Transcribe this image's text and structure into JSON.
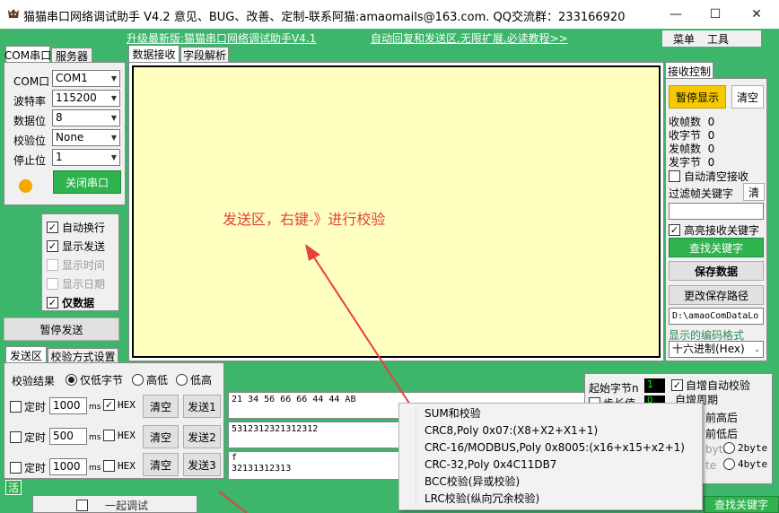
{
  "window": {
    "title": "猫猫串口网络调试助手 V4.2 意见、BUG、改善、定制-联系阿猫:amaomails@163.com. QQ交流群：233166920",
    "controls": [
      "—",
      "☐",
      "✕"
    ]
  },
  "topbar": {
    "upgrade_link": "升级最新版:猫猫串口网络调试助手V4.1",
    "auto_link": "自动回复和发送区,无限扩展,必读教程>>",
    "menu": "菜单",
    "tools": "工具"
  },
  "left_tabs": [
    "COM串口",
    "服务器"
  ],
  "serial": {
    "fields": [
      {
        "label": "COM口",
        "value": "COM1"
      },
      {
        "label": "波特率",
        "value": "115200"
      },
      {
        "label": "数据位",
        "value": "8"
      },
      {
        "label": "校验位",
        "value": "None"
      },
      {
        "label": "停止位",
        "value": "1"
      }
    ],
    "close_button": "关闭串口",
    "status_color": "#f5a700"
  },
  "options": [
    {
      "label": "自动换行",
      "checked": true,
      "enabled": true
    },
    {
      "label": "显示发送",
      "checked": true,
      "enabled": true
    },
    {
      "label": "显示时间",
      "checked": false,
      "enabled": false
    },
    {
      "label": "显示日期",
      "checked": false,
      "enabled": false
    },
    {
      "label": "仅数据",
      "checked": true,
      "enabled": true
    }
  ],
  "pause_send": "暂停发送",
  "center_tabs": [
    "数据接收",
    "字段解析"
  ],
  "annotation": "发送区，右键-》进行校验",
  "receive_control": {
    "tab": "接收控制",
    "pause_display": "暂停显示",
    "clear": "清空",
    "stats": [
      {
        "label": "收帧数",
        "value": "0"
      },
      {
        "label": "收字节",
        "value": "0"
      },
      {
        "label": "发帧数",
        "value": "0"
      },
      {
        "label": "发字节",
        "value": "0"
      }
    ],
    "auto_clear": "自动清空接收",
    "filter_label": "过滤帧关键字",
    "filter_clear": "清",
    "highlight": "高亮接收关键字",
    "find_keyword": "查找关键字",
    "save_data": "保存数据",
    "change_path": "更改保存路径",
    "path": "D:\\amaoComDataLo",
    "encoding_label": "显示的编码格式",
    "encoding": "十六进制(Hex)"
  },
  "send_tabs": [
    "发送区",
    "校验方式设置"
  ],
  "checksum": {
    "label": "校验结果",
    "options": [
      {
        "label": "仅低字节",
        "selected": true
      },
      {
        "label": "高低",
        "selected": false
      },
      {
        "label": "低高",
        "selected": false
      }
    ]
  },
  "send_rows": [
    {
      "timer": "定时",
      "interval": "1000",
      "unit": "ms",
      "hex": "HEX",
      "hex_checked": true,
      "clear": "清空",
      "send": "发送1",
      "data": "21 34 56 66 66 44 44 AB"
    },
    {
      "timer": "定时",
      "interval": "500",
      "unit": "ms",
      "hex": "HEX",
      "hex_checked": false,
      "clear": "清空",
      "send": "发送2",
      "data": "5312312321312312"
    },
    {
      "timer": "定时",
      "interval": "1000",
      "unit": "ms",
      "hex": "HEX",
      "hex_checked": false,
      "clear": "清空",
      "send": "发送3",
      "data_line1": "f",
      "data_line2": "32131312313"
    }
  ],
  "right_bottom": {
    "start_byte": "起始字节n",
    "start_value": "1",
    "auto_checksum": "自增自动校验",
    "step_label": "步长值",
    "step_value": "0",
    "auto_period": "自增周期",
    "high_low_after": "前高后",
    "low_high_after": "前低后",
    "byte1": "byte",
    "byte2": "2byte",
    "byte3": "te",
    "byte4": "4byte"
  },
  "context_menu": [
    "SUM和校验",
    "CRC8,Poly 0x07:(X8+X2+X1+1)",
    "CRC-16/MODBUS,Poly 0x8005:(x16+x15+x2+1)",
    "CRC-32,Poly 0x4C11DB7",
    "BCC校验(异或校验)",
    "LRC校验(纵向冗余校验)"
  ],
  "status": {
    "active": "活",
    "hidden_text": "一起调试",
    "find_keyword_bottom": "查找关键字"
  }
}
